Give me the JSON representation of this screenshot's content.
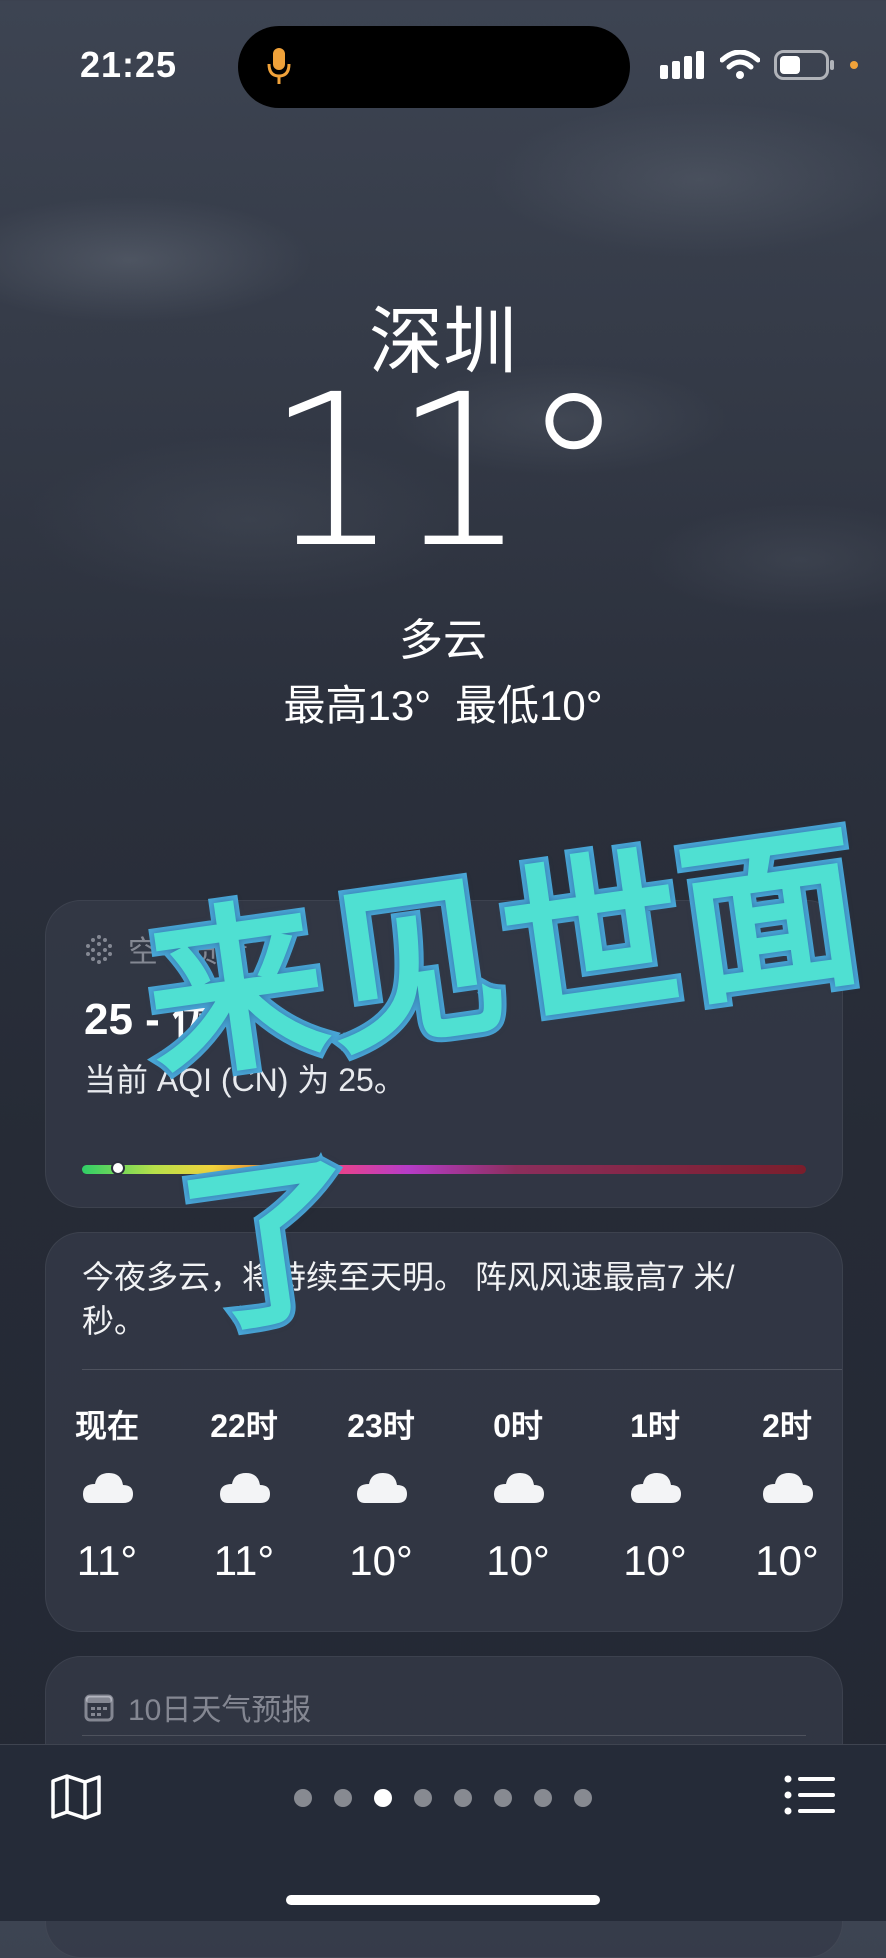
{
  "status_bar": {
    "time": "21:25"
  },
  "header": {
    "city": "深圳",
    "temperature": "11°",
    "condition": "多云",
    "high": "最高13°",
    "low": "最低10°"
  },
  "air_quality": {
    "title": "空气质量",
    "value": "25 - 优",
    "description": "当前 AQI (CN) 为 25。",
    "level_fraction": 0.05
  },
  "hourly": {
    "summary": "今夜多云，将持续至天明。 阵风风速最高7 米/秒。",
    "items": [
      {
        "label": "现在",
        "icon": "cloud-icon",
        "temp": "11°"
      },
      {
        "label": "22时",
        "icon": "cloud-icon",
        "temp": "11°"
      },
      {
        "label": "23时",
        "icon": "cloud-icon",
        "temp": "10°"
      },
      {
        "label": "0时",
        "icon": "cloud-icon",
        "temp": "10°"
      },
      {
        "label": "1时",
        "icon": "cloud-icon",
        "temp": "10°"
      },
      {
        "label": "2时",
        "icon": "cloud-icon",
        "temp": "10°"
      }
    ]
  },
  "forecast": {
    "title": "10日天气预报"
  },
  "pager": {
    "count": 8,
    "active_index": 2
  },
  "sticker": {
    "text": "来见世面了"
  }
}
